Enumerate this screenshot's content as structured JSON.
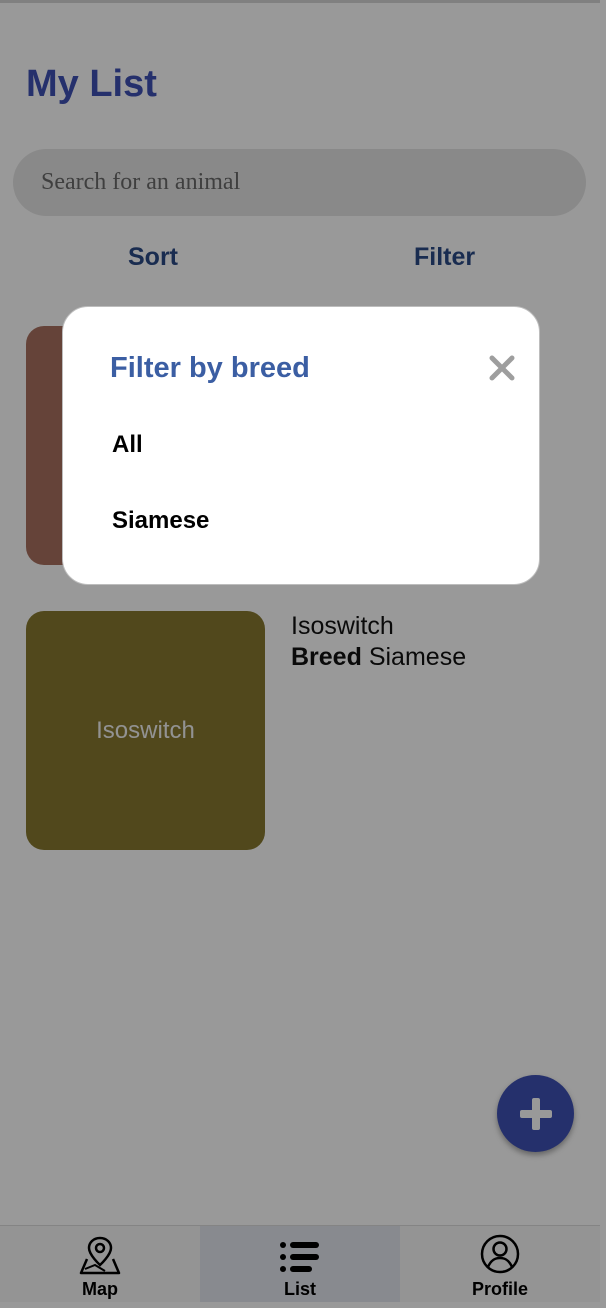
{
  "header": {
    "title": "My List"
  },
  "search": {
    "placeholder": "Search for an animal"
  },
  "toolbar": {
    "sort_label": "Sort",
    "filter_label": "Filter"
  },
  "animals": [
    {
      "thumb_color": "#a8705f"
    },
    {
      "thumb_label": "Isoswitch",
      "name": "Isoswitch",
      "breed_label": "Breed",
      "breed": "Siamese",
      "thumb_color": "#87792f"
    }
  ],
  "fab": {
    "icon": "plus-icon"
  },
  "navbar": {
    "items": [
      {
        "label": "Map",
        "icon": "map-pin-icon"
      },
      {
        "label": "List",
        "icon": "list-icon",
        "active": true
      },
      {
        "label": "Profile",
        "icon": "profile-icon"
      }
    ]
  },
  "filter_modal": {
    "title": "Filter by breed",
    "options": [
      "All",
      "Siamese"
    ]
  },
  "colors": {
    "accent": "#3f51b5",
    "modal_title": "#3b5ea3",
    "toolbar_text": "#2b4a86",
    "overlay": "rgba(0,0,0,0.40)"
  }
}
